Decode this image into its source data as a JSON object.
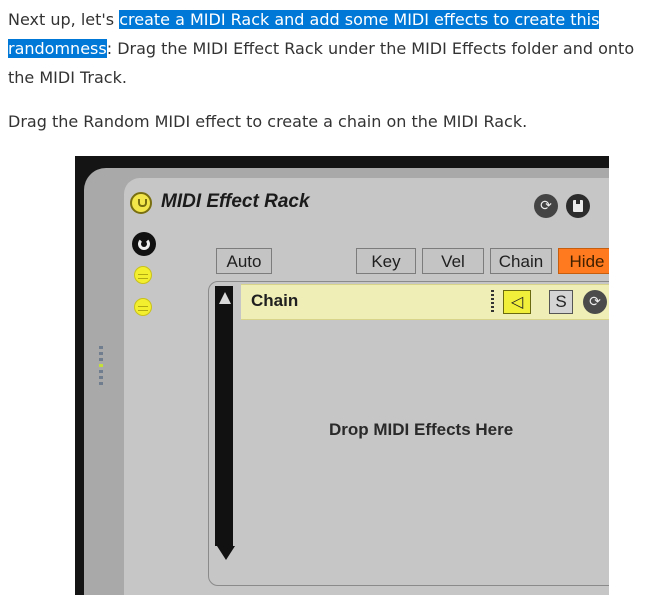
{
  "article": {
    "p1_before": "Next up, let's ",
    "p1_highlight": "create a MIDI Rack and add some MIDI effects to create this randomness",
    "p1_after": ": Drag the MIDI Effect Rack under the MIDI Effects folder and onto the MIDI Track.",
    "p2": "Drag the Random MIDI effect to create a chain on the MIDI Rack."
  },
  "rack": {
    "title": "MIDI Effect Rack",
    "buttons": {
      "auto": "Auto",
      "key": "Key",
      "vel": "Vel",
      "chain": "Chain",
      "hide": "Hide"
    },
    "chain_row": {
      "label": "Chain",
      "solo": "S",
      "speaker_icon": "speaker-icon",
      "hot_swap_icon": "hot-swap-icon"
    },
    "drop_text": "Drop MIDI Effects Here",
    "colors": {
      "hide_active": "#ff7a1e",
      "chain_row": "#efeeb7",
      "activator": "#f3ef2f",
      "highlight": "#0078d7"
    }
  }
}
